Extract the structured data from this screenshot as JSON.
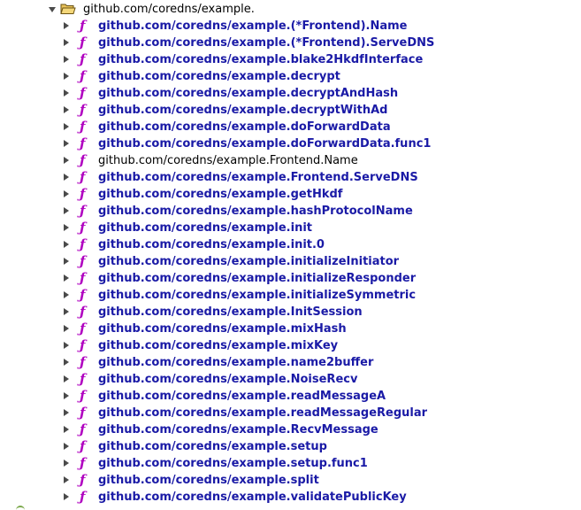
{
  "package": {
    "label": "github.com/coredns/example.",
    "icon": "folder-open-icon",
    "expanded": true
  },
  "items": [
    {
      "label": "github.com/coredns/example.(*Frontend).Name",
      "style": "link"
    },
    {
      "label": "github.com/coredns/example.(*Frontend).ServeDNS",
      "style": "link"
    },
    {
      "label": "github.com/coredns/example.blake2HkdfInterface",
      "style": "link"
    },
    {
      "label": "github.com/coredns/example.decrypt",
      "style": "link"
    },
    {
      "label": "github.com/coredns/example.decryptAndHash",
      "style": "link"
    },
    {
      "label": "github.com/coredns/example.decryptWithAd",
      "style": "link"
    },
    {
      "label": "github.com/coredns/example.doForwardData",
      "style": "link"
    },
    {
      "label": "github.com/coredns/example.doForwardData.func1",
      "style": "link"
    },
    {
      "label": "github.com/coredns/example.Frontend.Name",
      "style": "normal"
    },
    {
      "label": "github.com/coredns/example.Frontend.ServeDNS",
      "style": "link"
    },
    {
      "label": "github.com/coredns/example.getHkdf",
      "style": "link"
    },
    {
      "label": "github.com/coredns/example.hashProtocolName",
      "style": "link"
    },
    {
      "label": "github.com/coredns/example.init",
      "style": "link"
    },
    {
      "label": "github.com/coredns/example.init.0",
      "style": "link"
    },
    {
      "label": "github.com/coredns/example.initializeInitiator",
      "style": "link"
    },
    {
      "label": "github.com/coredns/example.initializeResponder",
      "style": "link"
    },
    {
      "label": "github.com/coredns/example.initializeSymmetric",
      "style": "link"
    },
    {
      "label": "github.com/coredns/example.InitSession",
      "style": "link"
    },
    {
      "label": "github.com/coredns/example.mixHash",
      "style": "link"
    },
    {
      "label": "github.com/coredns/example.mixKey",
      "style": "link"
    },
    {
      "label": "github.com/coredns/example.name2buffer",
      "style": "link"
    },
    {
      "label": "github.com/coredns/example.NoiseRecv",
      "style": "link"
    },
    {
      "label": "github.com/coredns/example.readMessageA",
      "style": "link"
    },
    {
      "label": "github.com/coredns/example.readMessageRegular",
      "style": "link"
    },
    {
      "label": "github.com/coredns/example.RecvMessage",
      "style": "link"
    },
    {
      "label": "github.com/coredns/example.setup",
      "style": "link"
    },
    {
      "label": "github.com/coredns/example.setup.func1",
      "style": "link"
    },
    {
      "label": "github.com/coredns/example.split",
      "style": "link"
    },
    {
      "label": "github.com/coredns/example.validatePublicKey",
      "style": "link"
    }
  ],
  "func_icon_glyph": "ƒ",
  "colors": {
    "link": "#1a1aa6",
    "func_icon": "#b000c0",
    "folder": "#e8c25a"
  }
}
